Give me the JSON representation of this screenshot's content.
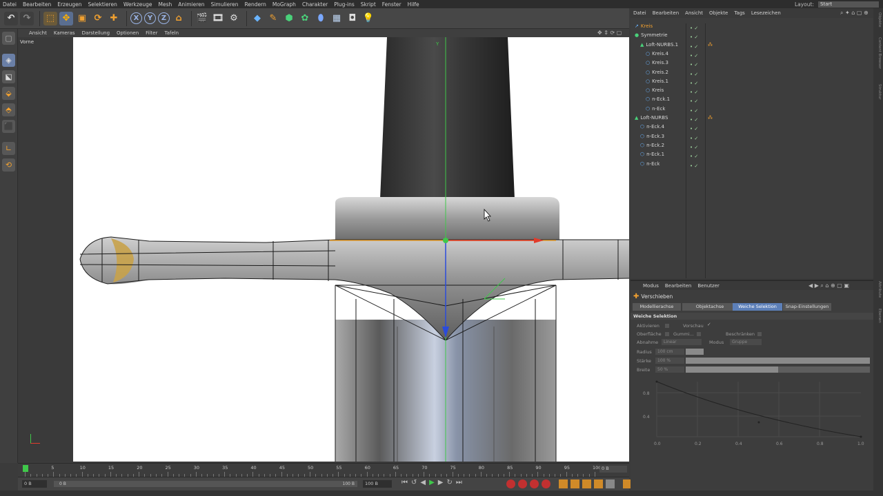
{
  "menubar": [
    "Datei",
    "Bearbeiten",
    "Erzeugen",
    "Selektieren",
    "Werkzeuge",
    "Mesh",
    "Animieren",
    "Simulieren",
    "Rendern",
    "MoGraph",
    "Charakter",
    "Plug-ins",
    "Skript",
    "Fenster",
    "Hilfe"
  ],
  "layout": {
    "label": "Layout:",
    "value": "Start"
  },
  "viewport_menu": [
    "Ansicht",
    "Kameras",
    "Darstellung",
    "Optionen",
    "Filter",
    "Tafeln"
  ],
  "viewport_name": "Vorne",
  "axis_y": "Y",
  "object_menu": [
    "Datei",
    "Bearbeiten",
    "Ansicht",
    "Objekte",
    "Tags",
    "Lesezeichen"
  ],
  "objects": [
    {
      "name": "Kreis",
      "indent": 0,
      "icon": "spline-icon",
      "highlight": true,
      "tag": false
    },
    {
      "name": "Symmetrie",
      "indent": 0,
      "icon": "symmetry-icon",
      "highlight": false,
      "tag": false
    },
    {
      "name": "Loft-NURBS.1",
      "indent": 1,
      "icon": "loft-icon",
      "highlight": false,
      "tag": true
    },
    {
      "name": "Kreis.4",
      "indent": 2,
      "icon": "circle-icon",
      "highlight": false,
      "tag": false
    },
    {
      "name": "Kreis.3",
      "indent": 2,
      "icon": "circle-icon",
      "highlight": false,
      "tag": false
    },
    {
      "name": "Kreis.2",
      "indent": 2,
      "icon": "circle-icon",
      "highlight": false,
      "tag": false
    },
    {
      "name": "Kreis.1",
      "indent": 2,
      "icon": "circle-icon",
      "highlight": false,
      "tag": false
    },
    {
      "name": "Kreis",
      "indent": 2,
      "icon": "circle-icon",
      "highlight": false,
      "tag": false
    },
    {
      "name": "n-Eck.1",
      "indent": 2,
      "icon": "polygon-icon",
      "highlight": false,
      "tag": false
    },
    {
      "name": "n-Eck",
      "indent": 2,
      "icon": "polygon-icon",
      "highlight": false,
      "tag": false
    },
    {
      "name": "Loft-NURBS",
      "indent": 0,
      "icon": "loft-icon",
      "highlight": false,
      "tag": true
    },
    {
      "name": "n-Eck.4",
      "indent": 1,
      "icon": "polygon-icon",
      "highlight": false,
      "tag": false
    },
    {
      "name": "n-Eck.3",
      "indent": 1,
      "icon": "polygon-icon",
      "highlight": false,
      "tag": false
    },
    {
      "name": "n-Eck.2",
      "indent": 1,
      "icon": "polygon-icon",
      "highlight": false,
      "tag": false
    },
    {
      "name": "n-Eck.1",
      "indent": 1,
      "icon": "polygon-icon",
      "highlight": false,
      "tag": false
    },
    {
      "name": "n-Eck",
      "indent": 1,
      "icon": "polygon-icon",
      "highlight": false,
      "tag": false
    }
  ],
  "attr": {
    "menu": [
      "Modus",
      "Bearbeiten",
      "Benutzer"
    ],
    "tool": "Verschieben",
    "tabs": [
      "Modellierachse",
      "Objektachse",
      "Weiche Selektion",
      "Snap-Einstellungen"
    ],
    "active_tab": 2,
    "section": "Weiche Selektion",
    "aktivieren": "Aktivieren",
    "vorschau": "Vorschau",
    "oberflaeche": "Oberfläche",
    "gummi": "Gummi...",
    "beschraenken": "Beschränken",
    "abnahme": "Abnahme",
    "abnahme_val": "Linear",
    "modus": "Modus",
    "modus_val": "Gruppe",
    "radius": "Radius",
    "radius_val": "100 cm",
    "staerke": "Stärke",
    "staerke_val": "100 %",
    "breite": "Breite",
    "breite_val": "50 %",
    "graph_y": [
      "0.8",
      "0.4"
    ],
    "graph_x": [
      "0.0",
      "0.2",
      "0.4",
      "0.6",
      "0.8",
      "1.0"
    ]
  },
  "timeline": {
    "ticks": [
      "0",
      "5",
      "10",
      "15",
      "20",
      "25",
      "30",
      "35",
      "40",
      "45",
      "50",
      "55",
      "60",
      "65",
      "70",
      "75",
      "80",
      "85",
      "90",
      "95",
      "100"
    ],
    "end": "0 B"
  },
  "transport": {
    "start": "0 B",
    "mid": "0 B",
    "range_end": "100 B",
    "end": "100 B"
  },
  "side_tabs": [
    "Objekte",
    "Content Browser",
    "Struktur",
    "Attribute",
    "Ebenen"
  ],
  "colors": {
    "accent": "#5c7fb8",
    "x_axis": "#e23b2b",
    "y_axis": "#3fc84a",
    "z_axis": "#2a4bdc",
    "orange": "#e8a030"
  }
}
